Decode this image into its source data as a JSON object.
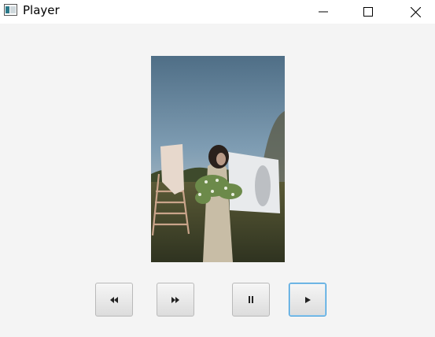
{
  "window": {
    "title": "Player",
    "icon": "window-app-icon",
    "controls": [
      "minimize-icon",
      "maximize-icon",
      "close-icon"
    ]
  },
  "video": {
    "description_icon": "video-frame",
    "sky_color": "#6f8ea8",
    "grass_color": "#4a4a2a"
  },
  "controls": {
    "rewind_icon": "rewind-icon",
    "forward_icon": "fast-forward-icon",
    "pause_icon": "pause-icon",
    "play_icon": "play-icon",
    "focused": "play"
  },
  "colors": {
    "background": "#f4f4f4",
    "titlebar": "#ffffff",
    "focus_border": "#3b9ad9"
  }
}
